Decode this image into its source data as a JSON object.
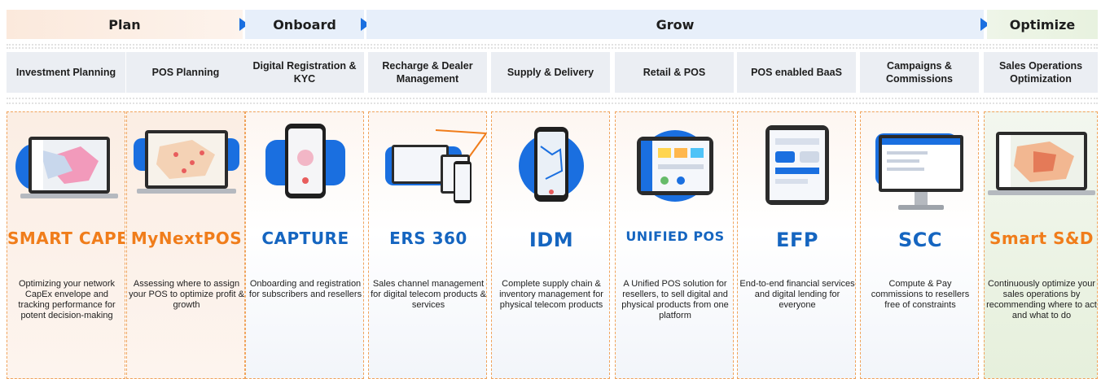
{
  "phases": [
    {
      "label": "Plan"
    },
    {
      "label": "Onboard"
    },
    {
      "label": "Grow"
    },
    {
      "label": "Optimize"
    }
  ],
  "colors": {
    "accent_blue": "#1a6fe0",
    "brand_orange": "#f07d1b",
    "brand_blue": "#1565c0",
    "phase_grey_blue": "#e7effa"
  },
  "modules": [
    {
      "label": "Investment Planning"
    },
    {
      "label": "POS Planning"
    },
    {
      "label": "Digital Registration & KYC"
    },
    {
      "label": "Recharge & Dealer Management"
    },
    {
      "label": "Supply & Delivery"
    },
    {
      "label": "Retail & POS"
    },
    {
      "label": "POS enabled BaaS"
    },
    {
      "label": "Campaigns & Commissions"
    },
    {
      "label": "Sales Operations Optimization"
    }
  ],
  "products": [
    {
      "brand": "SMART CAPEX",
      "icon": "laptop-map-icon",
      "description": "Optimizing your network CapEx envelope and tracking performance for potent decision-making"
    },
    {
      "brand": "MyNextPOS",
      "icon": "laptop-map-icon",
      "description": "Assessing where to assign your POS to optimize profit & growth"
    },
    {
      "brand": "CAPTURE",
      "icon": "phone-kyc-icon",
      "description": "Onboarding and registration for subscribers and resellers"
    },
    {
      "brand": "ERS 360",
      "icon": "multi-device-icon",
      "description": "Sales channel management for digital telecom products & services"
    },
    {
      "brand": "IDM",
      "icon": "phone-map-icon",
      "description": "Complete supply chain & inventory management for physical telecom products"
    },
    {
      "brand": "UNIFIED POS",
      "icon": "tablet-pos-icon",
      "description": "A Unified POS solution for resellers, to sell digital and physical products from one platform"
    },
    {
      "brand": "EFP",
      "icon": "tablet-finance-icon",
      "description": "End-to-end financial services and digital lending for everyone"
    },
    {
      "brand": "SCC",
      "icon": "monitor-commission-icon",
      "description": "Compute & Pay commissions to resellers free of constraints"
    },
    {
      "brand": "Smart S&D",
      "icon": "laptop-map-icon",
      "description": "Continuously optimize your sales operations by recommending where to act and what to do"
    }
  ]
}
